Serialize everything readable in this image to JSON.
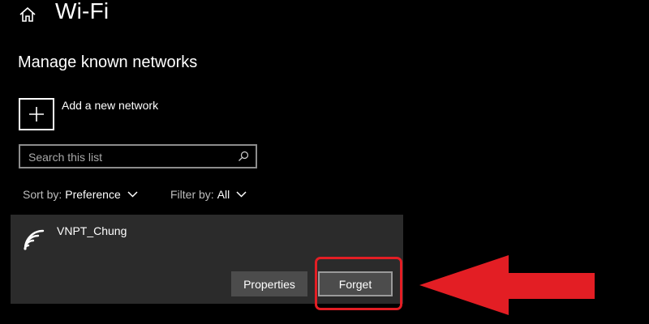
{
  "header": {
    "home_icon": "home-icon",
    "title": "Wi-Fi"
  },
  "section": {
    "title": "Manage known networks"
  },
  "add_network": {
    "icon": "plus-icon",
    "label": "Add a new network"
  },
  "search": {
    "placeholder": "Search this list",
    "value": "",
    "icon": "search-icon"
  },
  "sort": {
    "label": "Sort by:",
    "value": "Preference"
  },
  "filter": {
    "label": "Filter by:",
    "value": "All"
  },
  "networks": [
    {
      "name": "VNPT_Chung",
      "icon": "wifi-icon",
      "buttons": {
        "properties": "Properties",
        "forget": "Forget"
      }
    }
  ],
  "annotation": {
    "highlight_color": "#e31e24",
    "arrow_color": "#e31e24",
    "arrow_icon": "left-arrow-icon"
  }
}
